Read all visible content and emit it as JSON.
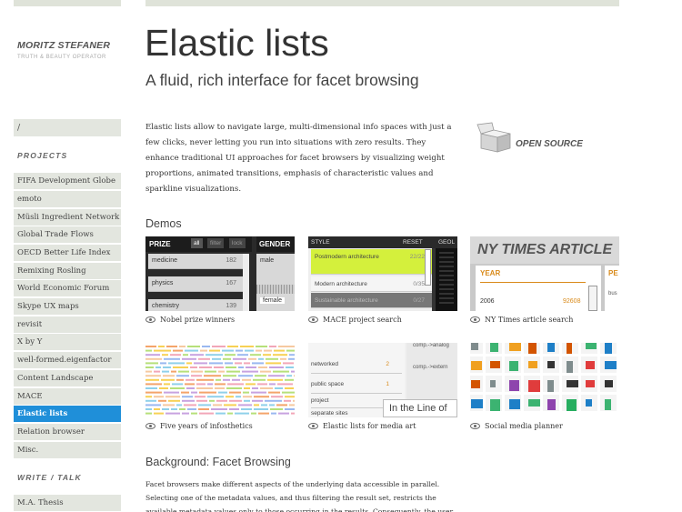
{
  "author": {
    "name": "MORITZ STEFANER",
    "tagline": "TRUTH & BEAUTY OPERATOR"
  },
  "nav": {
    "home": "/",
    "projects_heading": "PROJECTS",
    "projects": [
      "FIFA Development Globe",
      "emoto",
      "Müsli Ingredient Network",
      "Global Trade Flows",
      "OECD Better Life Index",
      "Remixing Rosling",
      "World Economic Forum",
      "Skype UX maps",
      "revisit",
      "X by Y",
      "well-formed.eigenfactor",
      "Content Landscape",
      "MACE",
      "Elastic lists",
      "Relation browser",
      "Misc."
    ],
    "active_project": "Elastic lists",
    "write_heading": "WRITE / TALK",
    "write_items": [
      "M.A. Thesis"
    ]
  },
  "page": {
    "title": "Elastic lists",
    "subtitle": "A fluid, rich interface for facet browsing",
    "intro": "Elastic lists allow to navigate large, multi-dimensional info spaces with just a few clicks, never letting you run into situations with zero results. They enhance traditional UI approaches for facet browsers by visualizing weight proportions, animated transitions, emphasis of characteristic values and sparkline visualizations.",
    "open_source_label": "OPEN SOURCE",
    "demos_heading": "Demos",
    "demos": [
      {
        "caption": "Nobel prize winners"
      },
      {
        "caption": "MACE project search"
      },
      {
        "caption": "NY Times article search"
      },
      {
        "caption": "Five years of infosthetics"
      },
      {
        "caption": "Elastic lists for media art"
      },
      {
        "caption": "Social media planner"
      }
    ],
    "background_heading": "Background: Facet Browsing",
    "background_text": "Facet browsers make different aspects of the underlying data accessible in parallel. Selecting one of the metadata values, and thus filtering the result set, restricts the available metadata values only to those occurring in the results. Consequently, the user"
  },
  "thumbs": {
    "nobel": {
      "prize_label": "PRIZE",
      "filters": [
        "all",
        "filter",
        "lock"
      ],
      "gender_label": "GENDER",
      "rows": [
        {
          "label": "medicine",
          "count": "182"
        },
        {
          "label": "physics",
          "count": "167"
        },
        {
          "label": "chemistry",
          "count": "139"
        }
      ],
      "gender_rows": [
        "male",
        "female"
      ]
    },
    "mace": {
      "style_label": "STYLE",
      "reset_label": "RESET",
      "geo_label": "GEOL",
      "rows": [
        {
          "label": "Postmodern architecture",
          "count": "22/22"
        },
        {
          "label": "Modern architecture",
          "count": "0/35"
        },
        {
          "label": "Sustainable architecture",
          "count": "0/27"
        }
      ]
    },
    "nyt": {
      "title": "NY TIMES ARTICLE",
      "year_label": "YEAR",
      "pe_label": "PE",
      "bus_label": "bus",
      "row_year": "2006",
      "row_count": "92608"
    },
    "media_art": {
      "top_text": "comp.->analog",
      "rows": [
        {
          "label": "networked",
          "count": "2"
        },
        {
          "label": "public space",
          "count": "1"
        },
        {
          "label": "project",
          "count": ""
        },
        {
          "label": "separate sites",
          "count": ""
        }
      ],
      "right_text": "comp.->extern",
      "overlay_text": "In the Line of"
    }
  },
  "colors": {
    "accent": "#1f8fd9",
    "nav_bg": "#e3e6df",
    "highlight_green": "#d4f03c"
  }
}
